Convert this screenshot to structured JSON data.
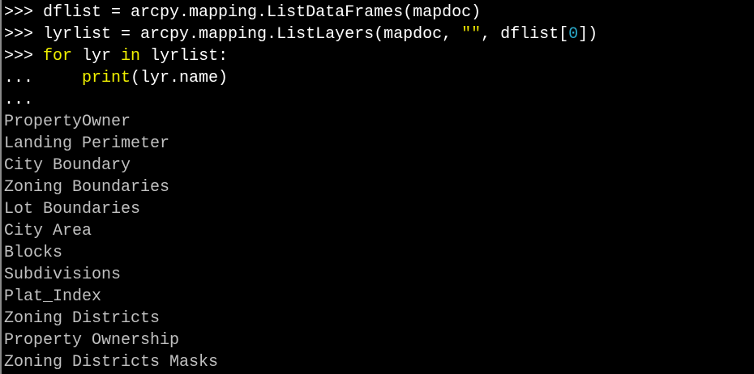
{
  "colors": {
    "background": "#000000",
    "text": "#ffffff",
    "output": "#c0c0c0",
    "keyword": "#f0f000",
    "string": "#e8e000",
    "number": "#2aa8c8"
  },
  "console": {
    "input": [
      {
        "prompt": ">>> ",
        "code": "dflist = arcpy.mapping.ListDataFrames(mapdoc)"
      },
      {
        "prompt": ">>> ",
        "code_a": "lyrlist = arcpy.mapping.ListLayers(mapdoc, ",
        "string": "\"\"",
        "code_b": ", dflist[",
        "number": "0",
        "code_c": "])"
      },
      {
        "prompt": ">>> ",
        "keyword1": "for",
        "code_a": " lyr ",
        "keyword2": "in",
        "code_b": " lyrlist:"
      },
      {
        "prompt": "...     ",
        "keyword": "print",
        "code": "(lyr.name)"
      },
      {
        "prompt": "..."
      }
    ],
    "output": [
      "PropertyOwner",
      "Landing Perimeter",
      "City Boundary",
      "Zoning Boundaries",
      "Lot Boundaries",
      "City Area",
      "Blocks",
      "Subdivisions",
      "Plat_Index",
      "Zoning Districts",
      "Property Ownership",
      "Zoning Districts Masks"
    ]
  }
}
